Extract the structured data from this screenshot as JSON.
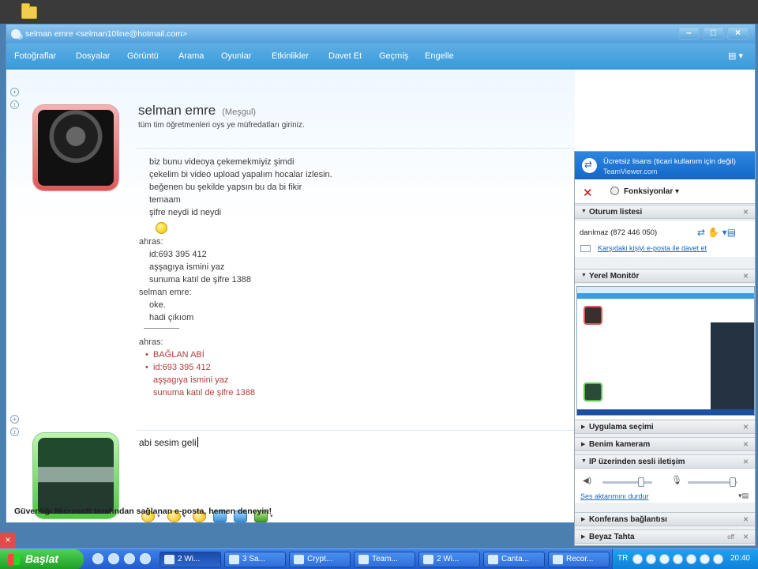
{
  "window": {
    "title": "selman emre <selman10line@hotmail.com>"
  },
  "menu": {
    "items": [
      "Fotoğraflar",
      "Dosyalar",
      "Görüntü",
      "Arama",
      "Oyunlar",
      "Etkinlikler",
      "Davet Et",
      "Geçmiş",
      "Engelle"
    ]
  },
  "contact": {
    "name": "selman emre",
    "status": "(Meşgul)",
    "personal_message": "tüm tim öğretmenleri oys ye müfredatları giriniz."
  },
  "chat": {
    "lines": [
      "biz bunu videoya çekemekmiyiz şimdi",
      "çekelim bi video upload yapalım hocalar izlesin.",
      "beğenen bu şekilde yapsın bu da bi fikir",
      "temaam",
      "şifre neydi id neydi"
    ],
    "speaker_ahras_1": "ahras:",
    "ahras_lines_1": [
      "id:693 395 412",
      "aşşagıya ismini yaz",
      "sunuma katıl de şifre 1388"
    ],
    "speaker_selman": "selman emre:",
    "selman_lines": [
      "oke.",
      "hadi çıkıom"
    ],
    "speaker_ahras_2": "ahras:",
    "ahras_red_lines": [
      "BAĞLAN ABİ",
      "id:693 395 412",
      "aşşagıya ismini yaz",
      "sunuma katıl de şifre 1388"
    ]
  },
  "input": {
    "value": "abi sesim geli"
  },
  "ad_banner": "Güvenliği Microsoft tarafından sağlanan e-posta, hemen deneyin!",
  "teamviewer": {
    "license_line1": "Ücretsiz lisans (ticari kullanım için değil)",
    "license_line2": "TeamViewer.com",
    "functions_label": "Fonksiyonlar",
    "sections": {
      "session_list": "Oturum listesi",
      "local_monitor": "Yerel Monitör",
      "app_selection": "Uygulama seçimi",
      "my_camera": "Benim kameram",
      "voip": "IP üzerinden sesli iletişim",
      "conference": "Konferans bağlantısı",
      "whiteboard": "Beyaz Tahta"
    },
    "session": {
      "name": "darılmaz (872 446 050)",
      "invite_link": "Karşıdaki kişiyi e-posta ile davet et"
    },
    "audio": {
      "volume_level": 0.78,
      "mic_level": 0.9,
      "stop_link": "Ses aktarımını durdur"
    },
    "whiteboard_toggle": "off"
  },
  "taskbar": {
    "start_label": "Başlat",
    "tasks": [
      "2 Wi...",
      "3 Sa...",
      "Crypt...",
      "Team...",
      "2 Wi...",
      "Canta...",
      "Recor..."
    ],
    "language": "TR",
    "clock": "20:40"
  }
}
